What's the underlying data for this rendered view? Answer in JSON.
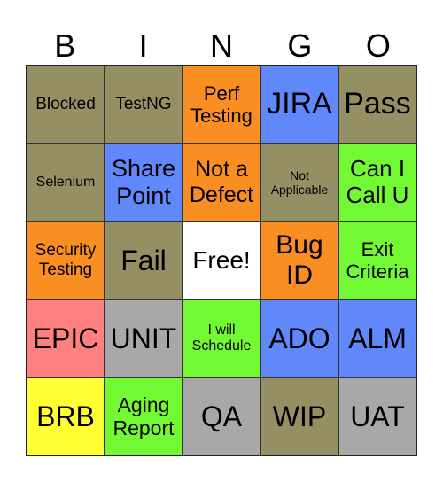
{
  "header": [
    "B",
    "I",
    "N",
    "G",
    "O"
  ],
  "colors": {
    "olive": "#959064",
    "orange": "#f98e23",
    "blue": "#6088fb",
    "green": "#72f934",
    "grey": "#a8a8a8",
    "pink": "#ff8080",
    "yellow": "#ffff33",
    "white": "#ffffff"
  },
  "cells": [
    {
      "text": "Blocked",
      "color": "olive",
      "size": 19
    },
    {
      "text": "TestNG",
      "color": "olive",
      "size": 19
    },
    {
      "text": "Perf Testing",
      "color": "orange",
      "size": 22
    },
    {
      "text": "JIRA",
      "color": "blue",
      "size": 34
    },
    {
      "text": "Pass",
      "color": "olive",
      "size": 34
    },
    {
      "text": "Selenium",
      "color": "olive",
      "size": 16
    },
    {
      "text": "Share Point",
      "color": "blue",
      "size": 27
    },
    {
      "text": "Not a Defect",
      "color": "orange",
      "size": 25
    },
    {
      "text": "Not Applicable",
      "color": "olive",
      "size": 14
    },
    {
      "text": "Can I Call U",
      "color": "green",
      "size": 26
    },
    {
      "text": "Security Testing",
      "color": "orange",
      "size": 19
    },
    {
      "text": "Fail",
      "color": "olive",
      "size": 32
    },
    {
      "text": "Free!",
      "color": "white",
      "size": 28
    },
    {
      "text": "Bug ID",
      "color": "orange",
      "size": 30
    },
    {
      "text": "Exit Criteria",
      "color": "green",
      "size": 22
    },
    {
      "text": "EPIC",
      "color": "pink",
      "size": 32
    },
    {
      "text": "UNIT",
      "color": "grey",
      "size": 32
    },
    {
      "text": "I will Schedule",
      "color": "green",
      "size": 16
    },
    {
      "text": "ADO",
      "color": "blue",
      "size": 32
    },
    {
      "text": "ALM",
      "color": "blue",
      "size": 32
    },
    {
      "text": "BRB",
      "color": "yellow",
      "size": 32
    },
    {
      "text": "Aging Report",
      "color": "green",
      "size": 23
    },
    {
      "text": "QA",
      "color": "grey",
      "size": 32
    },
    {
      "text": "WIP",
      "color": "olive",
      "size": 32
    },
    {
      "text": "UAT",
      "color": "grey",
      "size": 32
    }
  ]
}
